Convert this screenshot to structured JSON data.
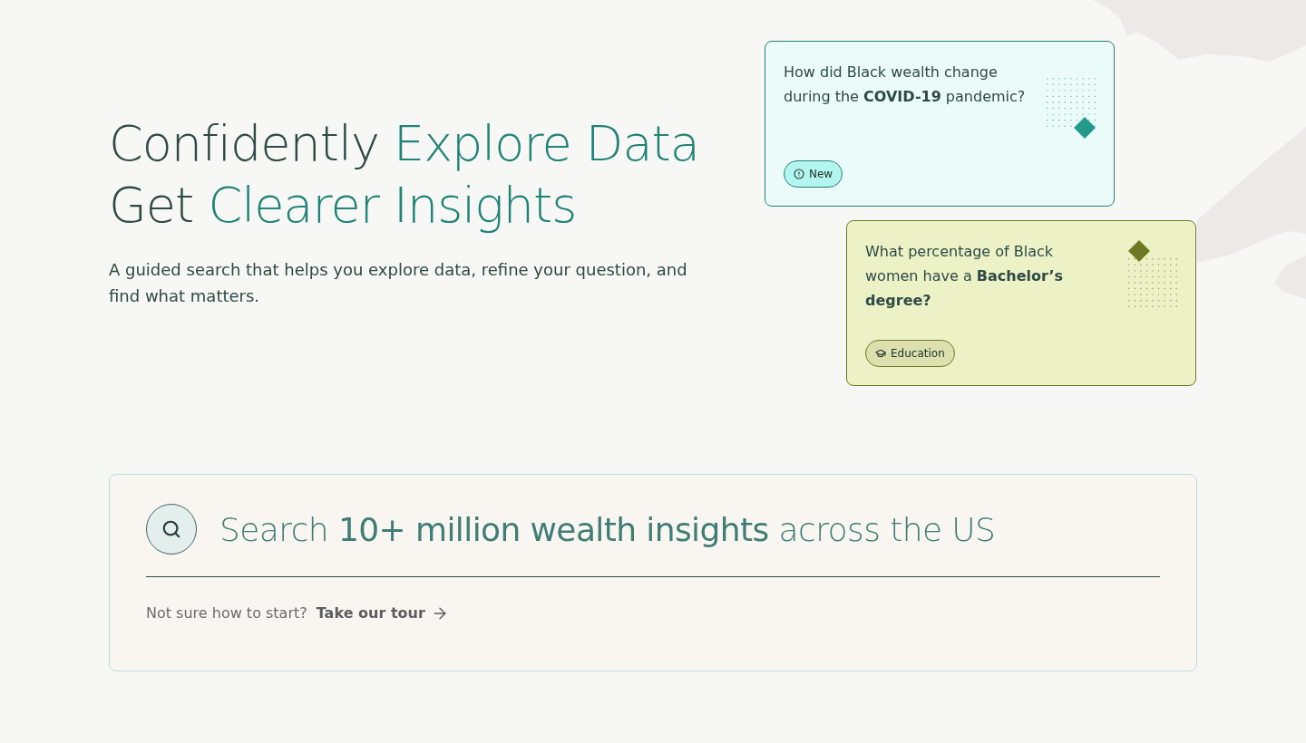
{
  "hero": {
    "heading": [
      {
        "parts": [
          {
            "text": "Confidently",
            "accent": false
          },
          {
            "text": "Explore Data",
            "accent": true
          }
        ]
      },
      {
        "parts": [
          {
            "text": "Get",
            "accent": false
          },
          {
            "text": "Clearer Insights",
            "accent": true
          }
        ]
      }
    ],
    "subtitle": "A guided search that helps you explore data, refine your question, and find what matters."
  },
  "question_cards": [
    {
      "question": "How did Black wealth change during the **COVID-19** pandemic?",
      "color": "#239a8c",
      "tag": {
        "label": "New",
        "kind": "new"
      }
    },
    {
      "question": "What percentage of Black women have a **Bachelor’s degree?**",
      "color": "#6f7722",
      "tag": {
        "label": "Education",
        "kind": "education"
      }
    }
  ],
  "search": {
    "prompt": "Search **10+ million wealth insights** across the US",
    "hint": "Not sure how to start?",
    "tour_link": "Take our tour"
  }
}
